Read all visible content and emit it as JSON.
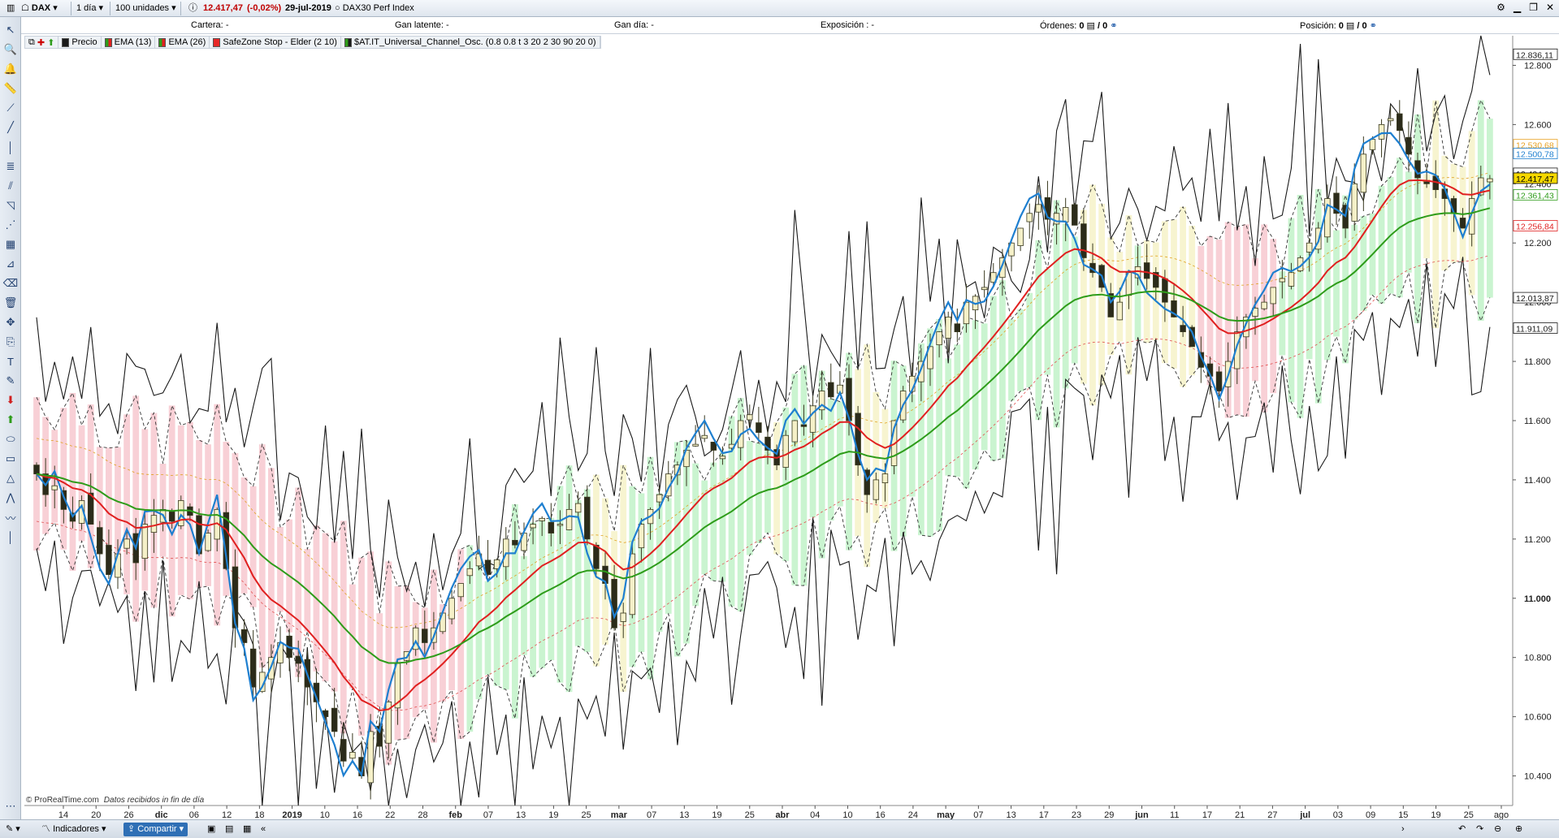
{
  "toolbar": {
    "symbol": "DAX",
    "timeframe": "1 día",
    "units": "100 unidades",
    "price": "12.417,47",
    "change": "(-0,02%)",
    "date": "29-jul-2019",
    "instrument": "DAX30 Perf Index"
  },
  "account": {
    "cartera_label": "Cartera:",
    "cartera_value": "-",
    "gan_latente_label": "Gan latente:",
    "gan_latente_value": "-",
    "gan_dia_label": "Gan día:",
    "gan_dia_value": "-",
    "exposicion_label": "Exposición :",
    "exposicion_value": "-",
    "ordenes_label": "Órdenes:",
    "ordenes_value": "0",
    "ordenes_total": "/ 0",
    "posicion_label": "Posición:",
    "posicion_value": "0",
    "posicion_total": "/ 0"
  },
  "legend": [
    {
      "label": "Precio",
      "color": "#1a1a1a"
    },
    {
      "label": "EMA (13)",
      "color": "#e02020"
    },
    {
      "label": "EMA (26)",
      "color": "#2e9c1a"
    },
    {
      "label": "SafeZone Stop - Elder (2 10)",
      "color": "#e82828"
    },
    {
      "label": "$AT.IT_Universal_Channel_Osc. (0.8 0.8 t 3 20 2 30 90 20 0)",
      "color": "#2e9c1a"
    }
  ],
  "footer": {
    "copyright": "© ProRealTime.com",
    "note": "Datos recibidos in fin de día",
    "indicators_label": "Indicadores",
    "share_label": "Compartir"
  },
  "chart_data": {
    "type": "candlestick",
    "colors": {
      "up": "#f5f0c8",
      "down": "#2b2b1a",
      "ema13": "#e02020",
      "ema26": "#2e9c1a",
      "blue_line": "#1e7fd0",
      "upper_band": "#1a1a1a",
      "channel_fill_up": "#b8f0c0",
      "channel_fill_down": "#f6c0c8",
      "channel_fill_neutral": "#f4f0c0"
    },
    "y_axis": {
      "min": 10300,
      "max": 12900,
      "ticks": [
        "12.800",
        "12.600",
        "12.400",
        "12.200",
        "12.000",
        "11.800",
        "11.600",
        "11.400",
        "11.200",
        "11.000",
        "10.800",
        "10.600",
        "10.400"
      ],
      "tick_values": [
        12800,
        12600,
        12400,
        12200,
        12000,
        11800,
        11600,
        11400,
        11200,
        11000,
        10800,
        10600,
        10400
      ],
      "price_labels": [
        {
          "text": "12.836,11",
          "value": 12836.11,
          "color": "#1a1a1a",
          "bg": "#ffffff"
        },
        {
          "text": "12.530,68",
          "value": 12530.68,
          "color": "#e8a020",
          "bg": "#ffffff"
        },
        {
          "text": "12.500,78",
          "value": 12500.78,
          "color": "#1e7fd0",
          "bg": "#ffffff"
        },
        {
          "text": "12.434,00",
          "value": 12434.0,
          "color": "#1a1a1a",
          "bg": "#ffffff"
        },
        {
          "text": "12.417,47",
          "value": 12417.47,
          "color": "#000000",
          "bg": "#f5d800"
        },
        {
          "text": "12.361,43",
          "value": 12361.43,
          "color": "#2e9c1a",
          "bg": "#ffffff"
        },
        {
          "text": "12.256,84",
          "value": 12256.84,
          "color": "#e02020",
          "bg": "#ffffff"
        },
        {
          "text": "12.013,87",
          "value": 12013.87,
          "color": "#1a1a1a",
          "bg": "#ffffff"
        },
        {
          "text": "11.911,09",
          "value": 11911.09,
          "color": "#1a1a1a",
          "bg": "#ffffff"
        }
      ]
    },
    "x_axis": {
      "labels": [
        "14",
        "20",
        "26",
        "dic",
        "06",
        "12",
        "18",
        "2019",
        "10",
        "16",
        "22",
        "28",
        "feb",
        "07",
        "13",
        "19",
        "25",
        "mar",
        "07",
        "13",
        "19",
        "25",
        "abr",
        "04",
        "10",
        "16",
        "24",
        "may",
        "07",
        "13",
        "17",
        "23",
        "29",
        "jun",
        "11",
        "17",
        "21",
        "27",
        "jul",
        "03",
        "09",
        "15",
        "19",
        "25",
        "ago"
      ],
      "bold": [
        "dic",
        "2019",
        "feb",
        "mar",
        "abr",
        "may",
        "jun",
        "jul"
      ]
    },
    "close_series": [
      11420,
      11350,
      11380,
      11300,
      11260,
      11330,
      11250,
      11150,
      11080,
      11150,
      11200,
      11120,
      11250,
      11280,
      11300,
      11260,
      11330,
      11280,
      11150,
      11220,
      11300,
      11100,
      10900,
      10850,
      10700,
      10750,
      10800,
      10850,
      10800,
      10780,
      10700,
      10650,
      10600,
      10550,
      10450,
      10480,
      10400,
      10550,
      10500,
      10650,
      10780,
      10820,
      10900,
      10850,
      10900,
      10950,
      11000,
      11050,
      11100,
      11150,
      11080,
      11130,
      11200,
      11180,
      11220,
      11250,
      11270,
      11220,
      11250,
      11300,
      11320,
      11200,
      11100,
      11050,
      10900,
      10950,
      11150,
      11250,
      11300,
      11350,
      11420,
      11450,
      11500,
      11520,
      11550,
      11500,
      11480,
      11520,
      11600,
      11620,
      11560,
      11500,
      11450,
      11550,
      11600,
      11580,
      11650,
      11700,
      11680,
      11720,
      11600,
      11450,
      11350,
      11400,
      11420,
      11600,
      11700,
      11750,
      11800,
      11850,
      11900,
      11950,
      11900,
      12000,
      12020,
      12050,
      12100,
      12150,
      12200,
      12250,
      12300,
      12330,
      12280,
      12300,
      12320,
      12260,
      12150,
      12100,
      12050,
      11950,
      12000,
      12100,
      12120,
      12080,
      12050,
      12000,
      11950,
      11900,
      11850,
      11780,
      11750,
      11700,
      11800,
      11900,
      11950,
      11980,
      12000,
      12050,
      12080,
      12100,
      12150,
      12200,
      12250,
      12350,
      12300,
      12250,
      12400,
      12500,
      12550,
      12600,
      12620,
      12580,
      12500,
      12420,
      12400,
      12380,
      12350,
      12300,
      12250,
      12350,
      12420,
      12417
    ],
    "ema13_series_note": "computed from close",
    "ema26_series_note": "computed from close"
  }
}
